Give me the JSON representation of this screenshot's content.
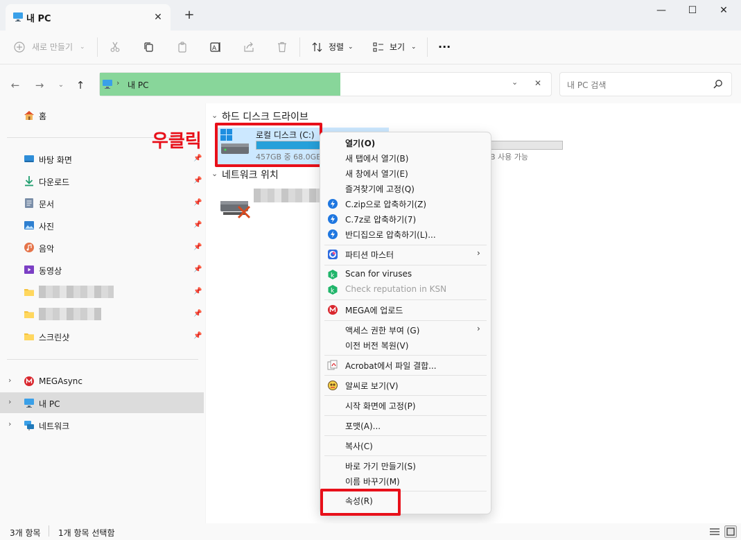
{
  "window": {
    "tab_title": "내 PC",
    "new_tab": "+",
    "close_tab": "✕",
    "minimize": "—",
    "maximize": "☐",
    "close": "✕"
  },
  "toolbar": {
    "new_label": "새로 만들기",
    "sort_label": "정렬",
    "view_label": "보기",
    "more": "···"
  },
  "address": {
    "crumb": "내 PC",
    "search_placeholder": "내 PC 검색"
  },
  "sidebar": {
    "home": "홈",
    "quick": [
      {
        "label": "바탕 화면",
        "icon": "desktop-icon"
      },
      {
        "label": "다운로드",
        "icon": "download-icon"
      },
      {
        "label": "문서",
        "icon": "document-icon"
      },
      {
        "label": "사진",
        "icon": "pictures-icon"
      },
      {
        "label": "음악",
        "icon": "music-icon"
      },
      {
        "label": "동영상",
        "icon": "video-icon"
      }
    ],
    "screenshot_folder": "스크린샷",
    "tree": [
      {
        "label": "MEGAsync",
        "icon": "mega-icon"
      },
      {
        "label": "내 PC",
        "icon": "pc-icon"
      },
      {
        "label": "네트워크",
        "icon": "network-icon"
      }
    ]
  },
  "content": {
    "section_drives": "하드 디스크 드라이브",
    "section_network": "네트워크 위치",
    "drive_c": {
      "name": "로컬 디스크 (C:)",
      "space": "457GB 중 68.0GB",
      "used_fraction": 0.85
    },
    "drive_d_space": "B 사용 가능",
    "annotation": "우클릭"
  },
  "context_menu": {
    "items": [
      {
        "label": "열기(O)",
        "bold": true
      },
      {
        "label": "새 탭에서 열기(B)"
      },
      {
        "label": "새 창에서 열기(E)"
      },
      {
        "label": "즐겨찾기에 고정(Q)"
      },
      {
        "label": "C.zip으로 압축하기(Z)",
        "icon": "bandizip-icon"
      },
      {
        "label": "C.7z로 압축하기(7)",
        "icon": "bandizip-icon"
      },
      {
        "label": "반디집으로 압축하기(L)...",
        "icon": "bandizip-icon"
      },
      {
        "label": "파티션 마스터",
        "icon": "partition-icon",
        "submenu": true
      },
      {
        "label": "Scan for viruses",
        "icon": "kaspersky-icon"
      },
      {
        "label": "Check reputation in KSN",
        "icon": "kaspersky-icon",
        "disabled": true
      },
      {
        "label": "MEGA에 업로드",
        "icon": "mega-icon"
      },
      {
        "label": "액세스 권한 부여 (G)",
        "submenu": true
      },
      {
        "label": "이전 버전 복원(V)"
      },
      {
        "label": "Acrobat에서 파일 결합...",
        "icon": "acrobat-icon"
      },
      {
        "label": "알씨로 보기(V)",
        "icon": "alsee-icon"
      },
      {
        "label": "시작 화면에 고정(P)"
      },
      {
        "label": "포맷(A)..."
      },
      {
        "label": "복사(C)"
      },
      {
        "label": "바로 가기 만들기(S)"
      },
      {
        "label": "이름 바꾸기(M)"
      },
      {
        "label": "속성(R)"
      }
    ]
  },
  "status": {
    "count": "3개 항목",
    "selected": "1개 항목 선택함"
  },
  "colors": {
    "accent": "#0067c0",
    "highlight_green": "#88d69a",
    "annotation_red": "#e8101a",
    "drive_bar": "#26a0da"
  }
}
